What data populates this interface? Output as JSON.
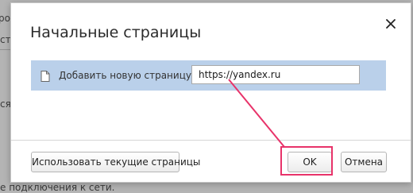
{
  "background": {
    "line1": "ро",
    "line2": "ст",
    "line3": "ся",
    "line4": "е подключения к сети."
  },
  "dialog": {
    "title": "Начальные страницы",
    "close_icon": "close-icon",
    "pages_row": {
      "icon": "document-icon",
      "label": "Добавить новую страницу",
      "url_value": "https://yandex.ru"
    },
    "buttons": {
      "use_current": "Использовать текущие страницы",
      "ok": "OK",
      "cancel": "Отмена"
    }
  },
  "colors": {
    "row_highlight": "#bad0ea",
    "annotation": "#e8336a"
  }
}
